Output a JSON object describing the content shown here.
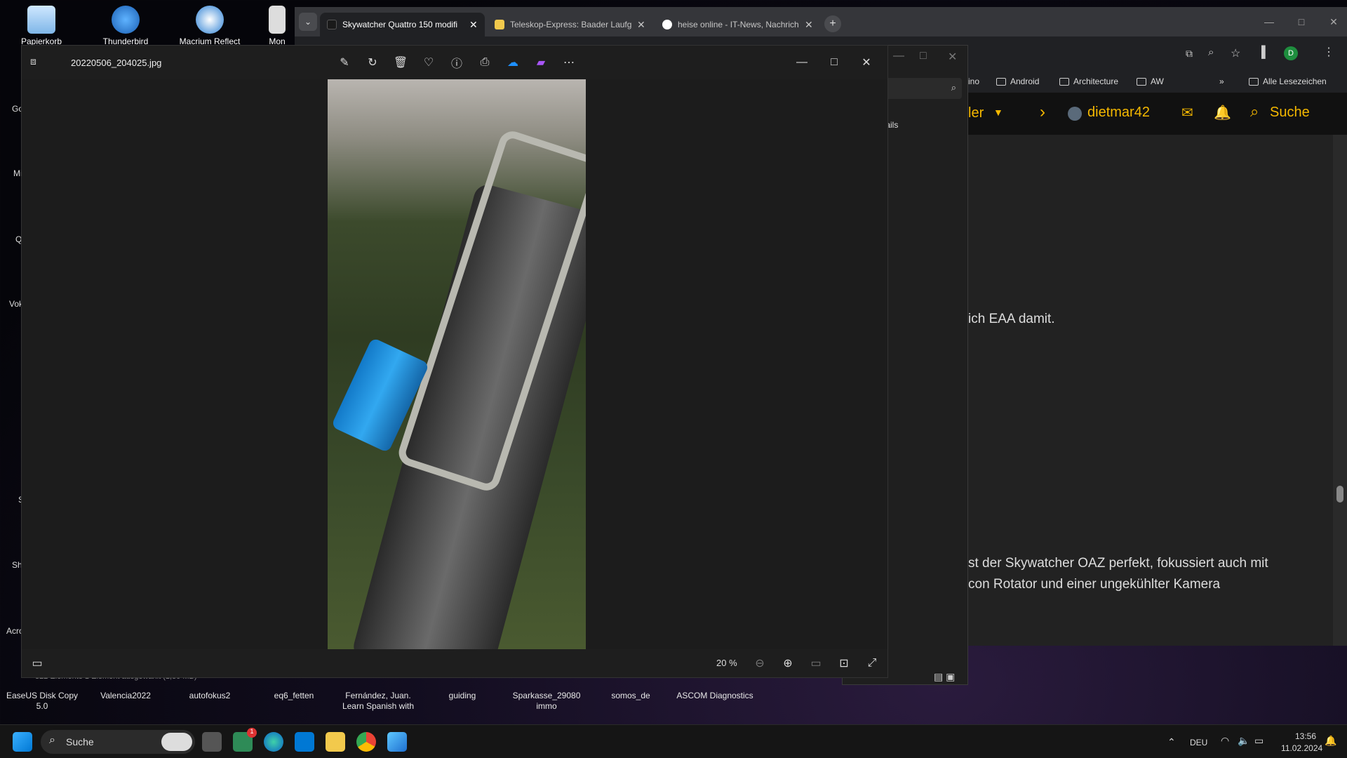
{
  "desktop": {
    "icons": [
      {
        "label": "Papierkorb"
      },
      {
        "label": "Thunderbird"
      },
      {
        "label": "Macrium Reflect"
      },
      {
        "label": "Mon"
      }
    ],
    "bottom_labels": [
      "EaseUS Disk Copy 5.0",
      "Valencia2022",
      "autofokus2",
      "eq6_fetten",
      "Fernández, Juan. Learn Spanish with",
      "guiding",
      "Sparkasse_29080 immo",
      "somos_de",
      "ASCOM Diagnostics"
    ],
    "left_labels": [
      "Go",
      "Mi",
      "Q",
      "Vok",
      "S",
      "Sh",
      "Acro"
    ]
  },
  "chrome": {
    "tabs": [
      {
        "label": "Skywatcher Quattro 150 modifi",
        "color": "#1a1a1a"
      },
      {
        "label": "Teleskop-Express: Baader Laufg",
        "color": "#f2c94c"
      },
      {
        "label": "heise online - IT-News, Nachrich",
        "color": "#ffffff"
      }
    ],
    "bookmarks": [
      "ino",
      "Android",
      "Architecture",
      "AW",
      "Alle Lesezeichen"
    ],
    "header": {
      "menu": "ler",
      "user": "dietmar42",
      "search": "Suche"
    },
    "content": [
      "ich EAA damit.",
      "st der Skywatcher OAZ perfekt, fokussiert auch mit",
      "con Rotator und einer ungekühlter Kamera"
    ],
    "avatar": "D"
  },
  "explorer": {
    "details": "Details",
    "status": "322 Elemente    1 Element ausgewählt (1,80 MB)"
  },
  "photos": {
    "filename": "20220506_204025.jpg",
    "zoom": "20 %"
  },
  "taskbar": {
    "search": "Suche",
    "lang": "DEU",
    "time": "13:56",
    "date": "11.02.2024",
    "badge": "1"
  }
}
